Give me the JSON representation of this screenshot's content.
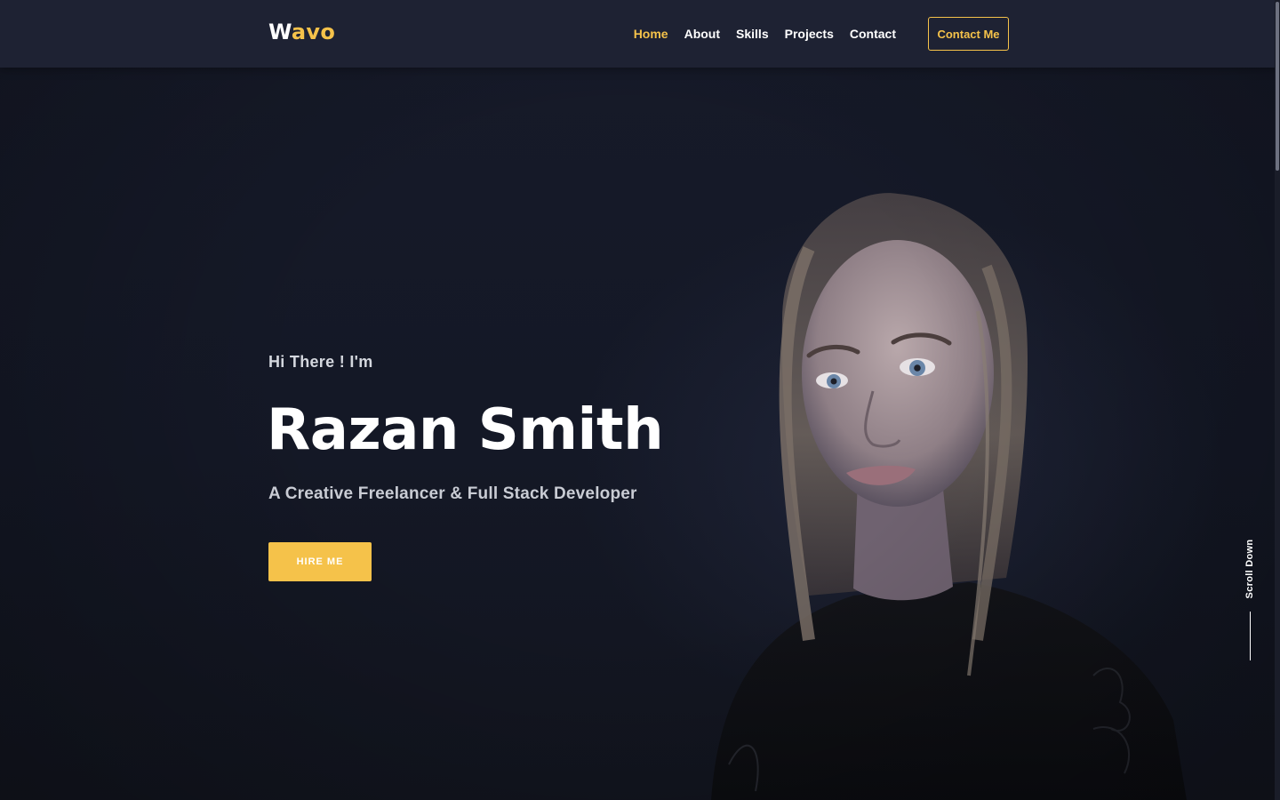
{
  "navbar": {
    "logo_first": "W",
    "logo_rest": "avo",
    "links": [
      {
        "label": "Home",
        "active": true
      },
      {
        "label": "About",
        "active": false
      },
      {
        "label": "Skills",
        "active": false
      },
      {
        "label": "Projects",
        "active": false
      },
      {
        "label": "Contact",
        "active": false
      }
    ],
    "contact_button": "Contact Me"
  },
  "hero": {
    "greeting": "Hi There ! I'm",
    "name": "Razan Smith",
    "tagline": "A Creative Freelancer & Full Stack Developer",
    "hire_button": "HIRE ME",
    "scroll_label": "Scroll Down"
  },
  "colors": {
    "accent": "#f5c24a",
    "navbar_bg": "#1e2233",
    "hero_bg": "#141826"
  }
}
